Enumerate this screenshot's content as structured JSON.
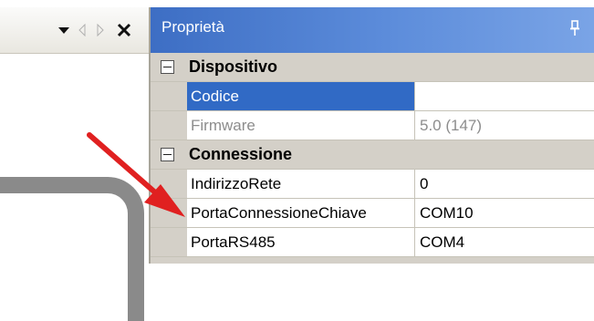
{
  "left_pane": {
    "tab_buttons": [
      {
        "icon": "chevron-down-icon"
      },
      {
        "icon": "chevron-left-icon"
      },
      {
        "icon": "chevron-right-icon"
      },
      {
        "icon": "close-icon"
      }
    ]
  },
  "properties": {
    "title": "Proprietà",
    "pin_icon": "pin-icon",
    "categories": [
      {
        "label": "Dispositivo",
        "items": [
          {
            "name": "Codice",
            "value": "",
            "selected": true,
            "readonly": false
          },
          {
            "name": "Firmware",
            "value": "5.0 (147)",
            "selected": false,
            "readonly": true
          }
        ]
      },
      {
        "label": "Connessione",
        "items": [
          {
            "name": "IndirizzoRete",
            "value": "0",
            "selected": false,
            "readonly": false
          },
          {
            "name": "PortaConnessioneChiave",
            "value": "COM10",
            "selected": false,
            "readonly": false
          },
          {
            "name": "PortaRS485",
            "value": "COM4",
            "selected": false,
            "readonly": false
          }
        ]
      }
    ]
  },
  "colors": {
    "title_bar": "#4a7bd0",
    "selection": "#316ac5",
    "arrow": "#e02020",
    "grid_gutter": "#d4d0c8"
  }
}
